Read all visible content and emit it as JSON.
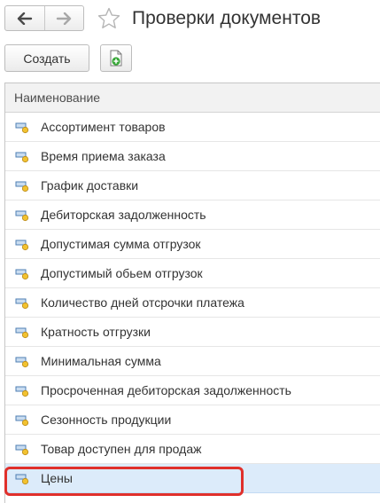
{
  "header": {
    "title": "Проверки документов",
    "back_icon": "arrow-left-icon",
    "forward_icon": "arrow-right-icon",
    "favorite_icon": "star-icon"
  },
  "toolbar": {
    "create_label": "Создать",
    "add_icon": "document-add-icon"
  },
  "table": {
    "column_name": "Наименование",
    "row_icon": "catalog-item-icon",
    "rows": [
      {
        "name": "Ассортимент товаров"
      },
      {
        "name": "Время приема заказа"
      },
      {
        "name": "График доставки"
      },
      {
        "name": "Дебиторская задолженность"
      },
      {
        "name": "Допустимая сумма отгрузок"
      },
      {
        "name": "Допустимый обьем отгрузок"
      },
      {
        "name": "Количество дней отсрочки платежа"
      },
      {
        "name": "Кратность отгрузки"
      },
      {
        "name": "Минимальная сумма"
      },
      {
        "name": "Просроченная дебиторская задолженность"
      },
      {
        "name": "Сезонность продукции"
      },
      {
        "name": "Товар доступен для продаж"
      },
      {
        "name": "Цены"
      }
    ],
    "selected_index": 12
  },
  "colors": {
    "selection": "#dcebfa",
    "highlight": "#e0302b",
    "add_icon_accent": "#3aa83a"
  }
}
